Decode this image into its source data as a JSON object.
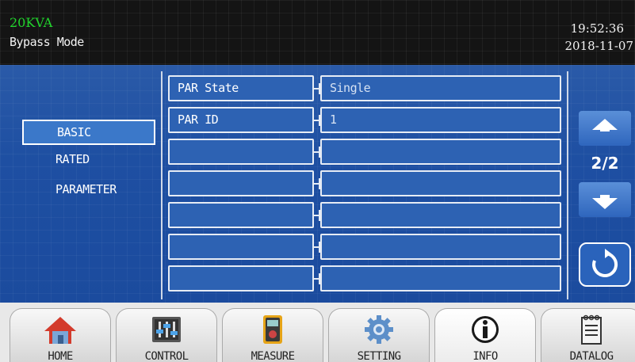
{
  "header": {
    "model": "20KVA",
    "mode": "Bypass Mode",
    "time": "19:52:36",
    "date": "2018-11-07"
  },
  "categories": [
    {
      "label": "BASIC",
      "selected": true
    },
    {
      "label": "RATED",
      "selected": false
    },
    {
      "label": "PARAMETER",
      "selected": false
    }
  ],
  "table": {
    "rows": [
      {
        "name": "PAR State",
        "value": "Single"
      },
      {
        "name": "PAR ID",
        "value": "1"
      },
      {
        "name": "",
        "value": ""
      },
      {
        "name": "",
        "value": ""
      },
      {
        "name": "",
        "value": ""
      },
      {
        "name": "",
        "value": ""
      },
      {
        "name": "",
        "value": ""
      }
    ]
  },
  "pager": {
    "indicator": "2/2",
    "up_icon": "arrow-up-icon",
    "down_icon": "arrow-down-icon",
    "refresh_icon": "refresh-icon"
  },
  "tabs": [
    {
      "label": "HOME",
      "icon": "home-icon"
    },
    {
      "label": "CONTROL",
      "icon": "sliders-icon"
    },
    {
      "label": "MEASURE",
      "icon": "meter-icon"
    },
    {
      "label": "SETTING",
      "icon": "gear-icon"
    },
    {
      "label": "INFO",
      "icon": "info-icon",
      "active": true
    },
    {
      "label": "DATALOG",
      "icon": "notepad-icon"
    }
  ],
  "colors": {
    "header_bg": "#141414",
    "model_text": "#21d52c",
    "panel_blue": "#1e4fa2",
    "selected_blue": "#3b78c9"
  }
}
